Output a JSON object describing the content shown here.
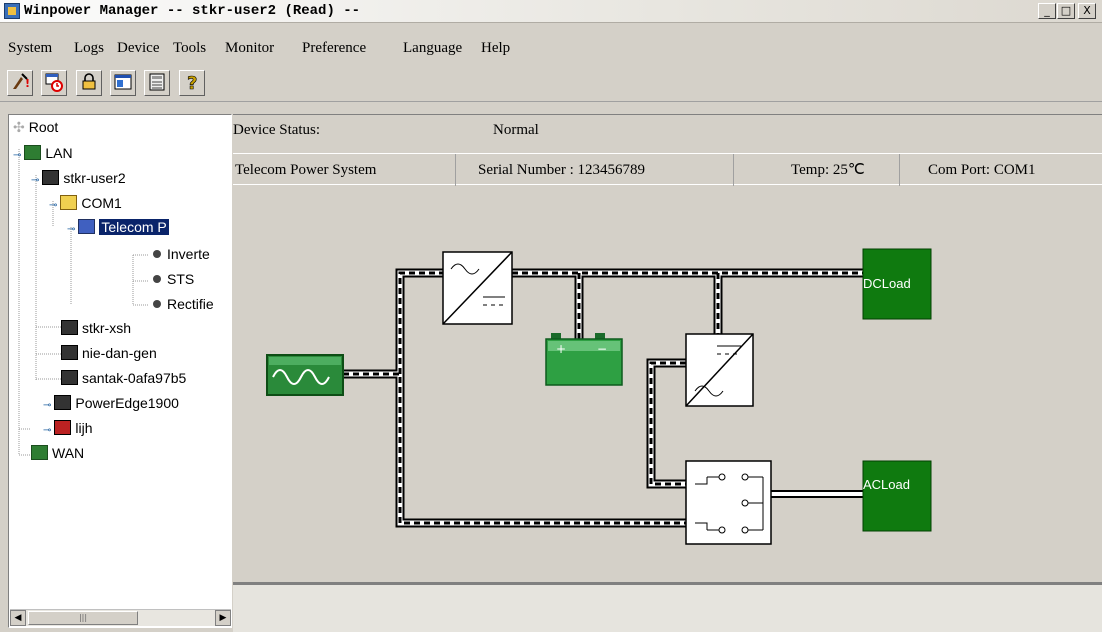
{
  "window": {
    "title": "Winpower Manager -- stkr-user2 (Read) --",
    "controls": [
      "_",
      "□",
      "X"
    ]
  },
  "menu": [
    "System",
    "Logs",
    "Device",
    "Tools",
    "Monitor",
    "Preference",
    "Language",
    "Help"
  ],
  "toolbar": {
    "buttons": [
      "wizard-icon",
      "schedule-icon",
      "lock-icon",
      "window-icon",
      "calculator-icon",
      "help-icon"
    ]
  },
  "tree": {
    "root": "Root",
    "lan": "LAN",
    "host1": "stkr-user2",
    "com": "COM1",
    "device": "Telecom P",
    "children": [
      "Inverte",
      "STS",
      "Rectifie"
    ],
    "hosts": [
      "stkr-xsh",
      "nie-dan-gen",
      "santak-0afa97b5",
      "PowerEdge1900",
      "lijh"
    ],
    "wan": "WAN"
  },
  "status": {
    "label": "Device Status:",
    "value": "Normal"
  },
  "info": {
    "system": "Telecom Power System",
    "serial": "Serial Number : 123456789",
    "temp": "Temp: 25℃",
    "port": "Com Port: COM1"
  },
  "diagram": {
    "dc_load": "DCLoad",
    "ac_load": "ACLoad",
    "battery_plus": "+",
    "battery_minus": "−"
  },
  "colors": {
    "load_green": "#1a8a1a",
    "battery_green": "#2ea043",
    "selection": "#0a246a"
  }
}
